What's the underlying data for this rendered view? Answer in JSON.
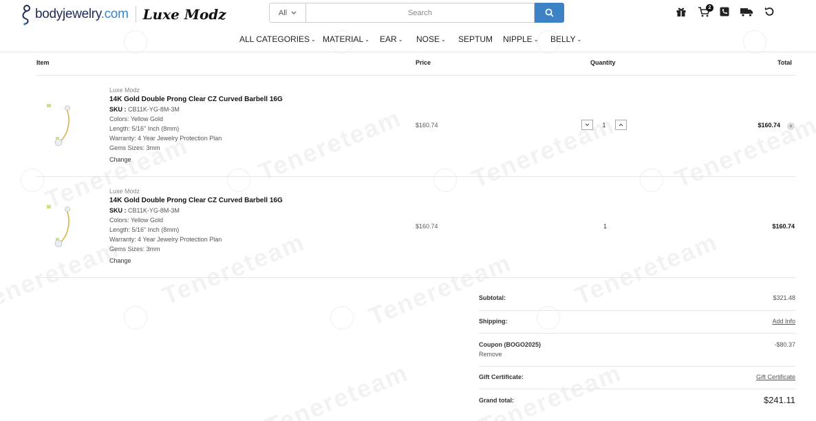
{
  "header": {
    "logo_brand": "bodyjewelry",
    "logo_tld": ".com",
    "logo_partner": "Luxe Modz",
    "search": {
      "category": "All",
      "placeholder": "Search"
    },
    "cart_count": "2",
    "icons": [
      "gift-icon",
      "cart-icon",
      "phone-icon",
      "truck-icon",
      "refresh-icon"
    ]
  },
  "nav": {
    "items": [
      {
        "label": "ALL CATEGORIES",
        "has_chevron": true
      },
      {
        "label": "MATERIAL",
        "has_chevron": true
      },
      {
        "label": "EAR",
        "has_chevron": true
      },
      {
        "label": "NOSE",
        "has_chevron": true
      },
      {
        "label": "SEPTUM",
        "has_chevron": false
      },
      {
        "label": "NIPPLE",
        "has_chevron": true
      },
      {
        "label": "BELLY",
        "has_chevron": true
      }
    ]
  },
  "table": {
    "headers": {
      "item": "Item",
      "price": "Price",
      "quantity": "Quantity",
      "total": "Total"
    },
    "rows": [
      {
        "brand": "Luxe Modz",
        "name": "14K Gold Double Prong Clear CZ Curved Barbell 16G",
        "sku_label": "SKU :",
        "sku": "CB11K-YG-8M-3M",
        "colors": "Colors: Yellow Gold",
        "length": "Length: 5/16\" Inch (8mm)",
        "warranty": "Warranty: 4 Year Jewelry Protection Plan",
        "gems": "Gems Sizes: 3mm",
        "change": "Change",
        "price": "$160.74",
        "quantity": "1",
        "total": "$160.74"
      },
      {
        "brand": "Luxe Modz",
        "name": "14K Gold Double Prong Clear CZ Curved Barbell 16G",
        "sku_label": "SKU :",
        "sku": "CB11K-YG-8M-3M",
        "colors": "Colors: Yellow Gold",
        "length": "Length: 5/16\" Inch (8mm)",
        "warranty": "Warranty: 4 Year Jewelry Protection Plan",
        "gems": "Gems Sizes: 3mm",
        "change": "Change",
        "price": "$160.74",
        "quantity": "1",
        "total": "$160.74"
      }
    ]
  },
  "summary": {
    "subtotal_label": "Subtotal:",
    "subtotal_value": "$321.48",
    "shipping_label": "Shipping:",
    "shipping_value": "Add Info",
    "coupon_label": "Coupon (BOGO2025)",
    "coupon_remove": "Remove",
    "coupon_value": "-$80.37",
    "gift_label": "Gift Certificate:",
    "gift_value": "Gift Certificate",
    "grand_label": "Grand total:",
    "grand_value": "$241.11"
  },
  "watermark": "Tenereteam",
  "colors": {
    "accent": "#3d82c4",
    "brand_navy": "#1c2a55"
  }
}
